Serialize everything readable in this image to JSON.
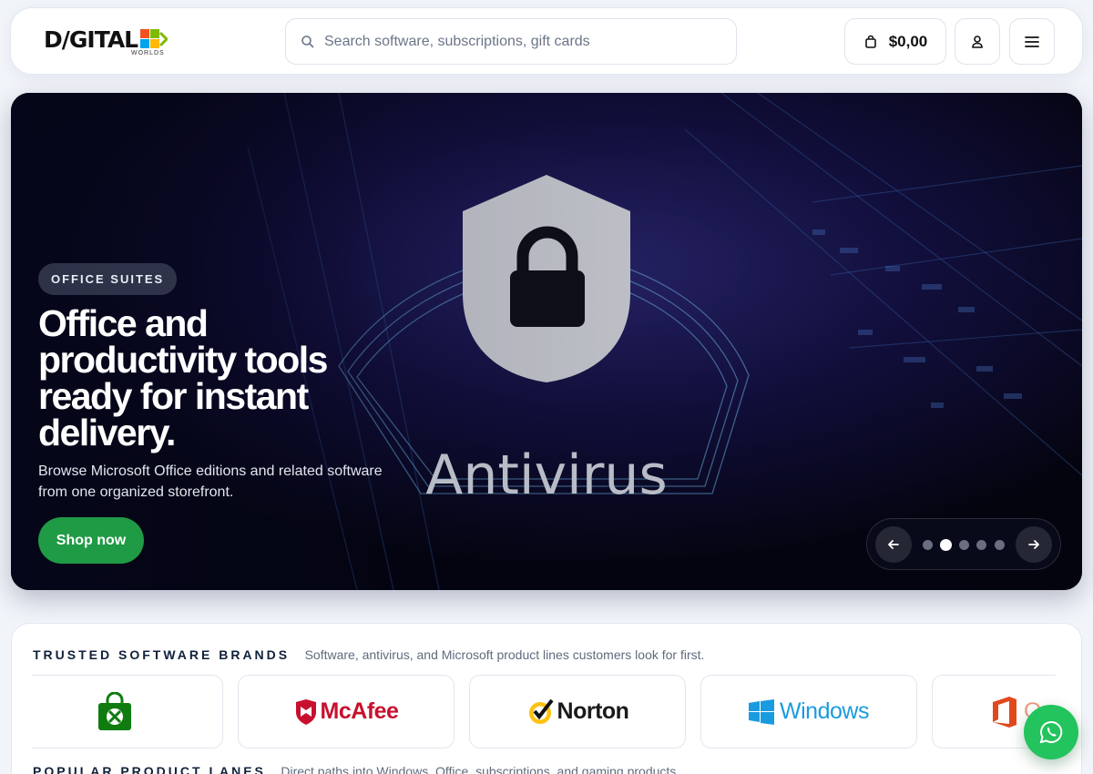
{
  "header": {
    "logo_text": "D/GITAL",
    "logo_sub": "WORLDS",
    "search": {
      "placeholder": "Search software, subscriptions, gift cards",
      "icon": "search-icon"
    },
    "cart": {
      "amount": "$0,00",
      "icon": "shopping-bag-icon"
    },
    "account_icon": "user-icon",
    "menu_icon": "hamburger-menu-icon"
  },
  "hero": {
    "badge": "OFFICE SUITES",
    "title": "Office and productivity tools ready for instant delivery.",
    "description": "Browse Microsoft Office editions and related software from one organized storefront.",
    "cta": "Shop now",
    "image_caption": "Antivirus",
    "carousel": {
      "slides": 5,
      "active": 2
    }
  },
  "brands_section": {
    "title": "TRUSTED SOFTWARE BRANDS",
    "subtitle": "Software, antivirus, and Microsoft product lines customers look for first.",
    "brands": [
      {
        "name": "",
        "icon": "xbox-store-icon",
        "color": "#107c10"
      },
      {
        "name": "McAfee",
        "icon": "mcafee-shield-icon",
        "color": "#c8102e"
      },
      {
        "name": "Norton",
        "icon": "norton-check-icon",
        "color": "#1a1a1a"
      },
      {
        "name": "Windows",
        "icon": "windows-logo-icon",
        "color": "#1a9be0"
      },
      {
        "name": "O",
        "icon": "office-logo-icon",
        "color": "#e2481c"
      }
    ]
  },
  "lanes_section": {
    "title": "POPULAR PRODUCT LANES",
    "subtitle": "Direct paths into Windows, Office, subscriptions, and gaming products."
  },
  "whatsapp_icon": "whatsapp-icon",
  "colors": {
    "accent_green": "#1f9a45",
    "whatsapp_green": "#23c35e",
    "text_dark": "#0f1a2b"
  }
}
